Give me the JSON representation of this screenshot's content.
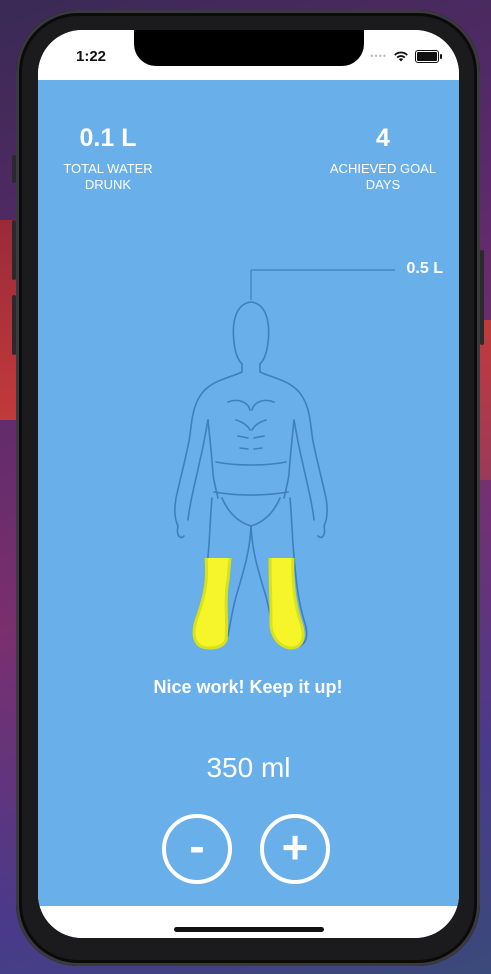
{
  "status_bar": {
    "time": "1:22",
    "signal_icon": "signal-dots-icon",
    "wifi_icon": "wifi-icon",
    "battery_icon": "battery-icon"
  },
  "stats": {
    "total_water": {
      "value": "0.1 L",
      "label": "TOTAL WATER DRUNK"
    },
    "goal_days": {
      "value": "4",
      "label": "ACHIEVED GOAL DAYS"
    }
  },
  "goal": {
    "label": "0.5 L"
  },
  "progress": {
    "fill_fraction": 0.2,
    "fill_color": "#f5f52a"
  },
  "message": "Nice work! Keep it up!",
  "amount": "350 ml",
  "buttons": {
    "minus": "-",
    "plus": "+"
  },
  "colors": {
    "background": "#69afe9",
    "text": "#ffffff",
    "outline": "#3f7fc0"
  }
}
